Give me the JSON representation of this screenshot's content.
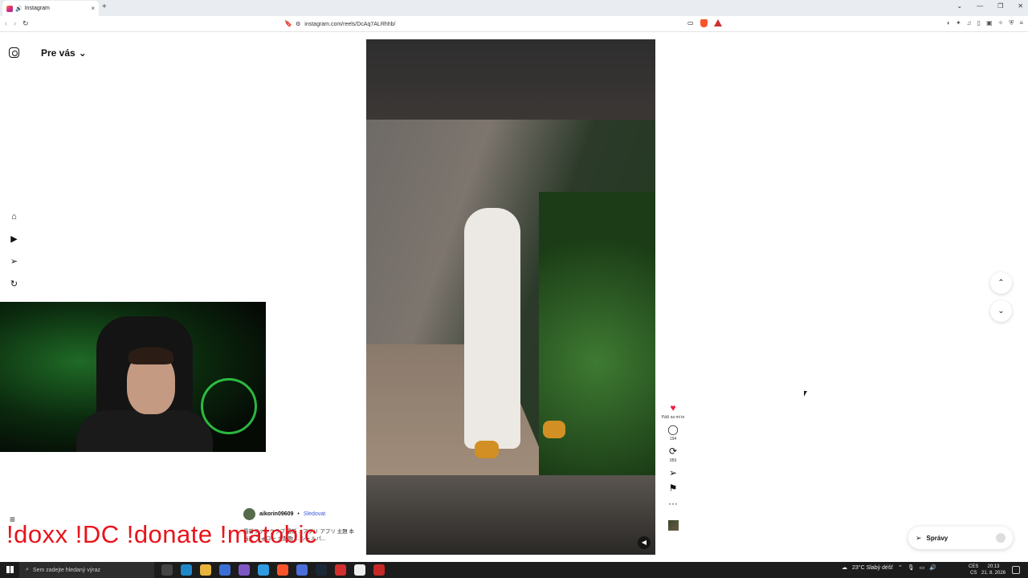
{
  "browser": {
    "tab_title": "Instagram",
    "url": "instagram.com/reels/DcAq7ALRhhb/",
    "new_tab_symbol": "+",
    "close_symbol": "×"
  },
  "instagram": {
    "feed_title": "Pre vás",
    "reel": {
      "likes_label": "Páči sa mi to",
      "comments": "194",
      "reposts": "959",
      "author": "aikorin09609",
      "follow_label": "Sledovat",
      "caption": "最新ファンクラブ 最新 ...アプリ アプリ 主題 本当に フォロー 主題歌 ... シェルパ..."
    },
    "messages_label": "Správy"
  },
  "stream_overlay": {
    "commands": "!doxx  !DC !donate !matobic"
  },
  "taskbar": {
    "search_placeholder": "Sem zadejte hledaný výraz",
    "weather": "23°C  Slabý déšť",
    "lang_top": "CES",
    "lang_bottom": "CS",
    "time": "20:13",
    "date": "21. 8. 2026"
  },
  "colors": {
    "like_red": "#ed1d45",
    "follow_blue": "#3a57d8",
    "overlay_red": "#e8141c",
    "taskbar_bg": "#1c1c1c"
  },
  "icons": [
    "instagram-icon",
    "home-icon",
    "reels-icon",
    "direct-icon",
    "explore-icon",
    "heart-icon",
    "comment-icon",
    "repost-icon",
    "share-icon",
    "save-icon",
    "more-icon",
    "chevron-up-icon",
    "chevron-down-icon",
    "mute-icon",
    "send-icon"
  ]
}
